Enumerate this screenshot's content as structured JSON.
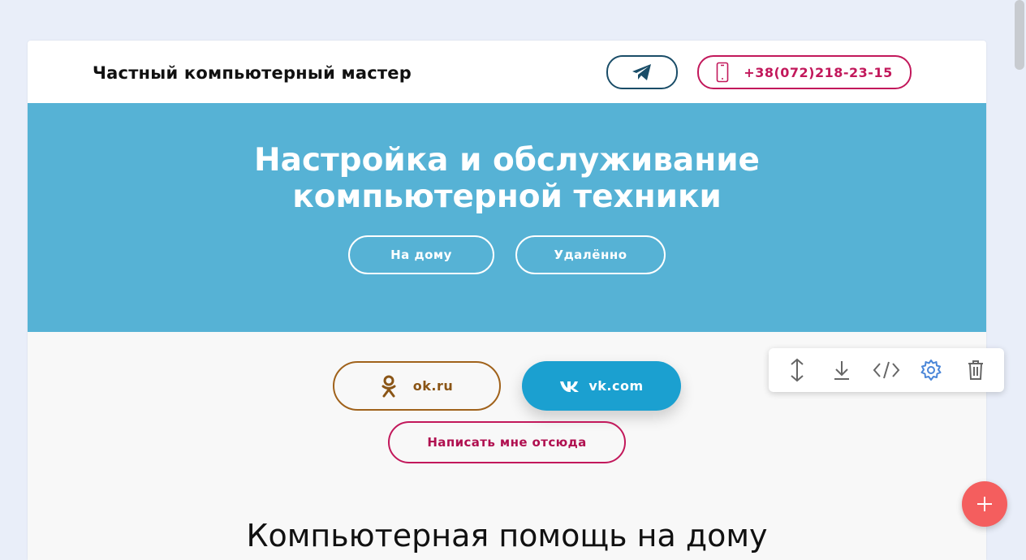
{
  "header": {
    "site_title": "Частный компьютерный мастер",
    "phone": "+38(072)218-23-15",
    "telegram_icon": "paper-plane-icon",
    "phone_icon": "smartphone-icon"
  },
  "hero": {
    "title_line1": "Настройка и обслуживание",
    "title_line2": "компьютерной техники",
    "buttons": [
      {
        "label": "На дому"
      },
      {
        "label": "Удалённо"
      }
    ]
  },
  "social": {
    "ok_label": "ok.ru",
    "vk_label": "vk.com",
    "write_label": "Написать мне отсюда"
  },
  "section": {
    "heading": "Компьютерная помощь на дому"
  },
  "editor_toolbar": {
    "tools": [
      "move-vertical-icon",
      "download-icon",
      "code-icon",
      "gear-icon",
      "trash-icon"
    ]
  },
  "fab": {
    "icon": "plus-icon"
  },
  "colors": {
    "hero_bg": "#56b2d5",
    "accent_pink": "#c2185b",
    "telegram_border": "#1a4d68",
    "ok_brown": "#a0621b",
    "vk_blue": "#1ba0d0",
    "fab_red": "#f45e5e"
  }
}
